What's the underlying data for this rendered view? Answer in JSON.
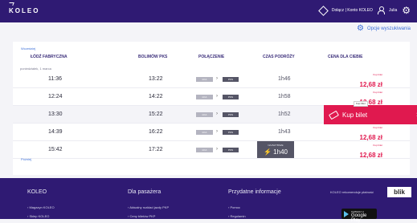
{
  "header": {
    "logo": "KOLEO",
    "account_link": "Dołącz | Konto KOLEO",
    "user_name": "Julia"
  },
  "search_options": "Opcje wyszukiwania",
  "results": {
    "earlier_label": "Wcześniej",
    "later_label": "Później",
    "date_label": "poniedziałek, 1 marca",
    "columns": {
      "from": "ŁÓDŹ FABRYCZNA",
      "to": "BOLIMÓW PKS",
      "connection": "POŁĄCZENIE",
      "duration": "CZAS PODRÓŻY",
      "price": "CENA DLA CIEBIE"
    },
    "rows": [
      {
        "dep": "11:36",
        "arr": "13:22",
        "seg1": "ŁKA",
        "seg2": "PKS",
        "duration": "1h46",
        "price_from": "Kup bilet",
        "price": "12,68 zł"
      },
      {
        "dep": "12:24",
        "arr": "14:22",
        "seg1": "ŁKA",
        "seg2": "PKS",
        "duration": "1h58",
        "price_from": "Kup bilet",
        "price": "12,68 zł"
      },
      {
        "dep": "13:30",
        "arr": "15:22",
        "seg1": "ŁKA",
        "seg2": "PKS",
        "duration": "1h52",
        "price_from": "Kup bilet",
        "price": "12,68 zł"
      },
      {
        "dep": "14:39",
        "arr": "16:22",
        "seg1": "ŁKA",
        "seg2": "PKS",
        "duration": "1h43",
        "price_from": "Kup bilet",
        "price": "12,68 zł"
      },
      {
        "dep": "15:42",
        "arr": "17:22",
        "seg1": "ŁKA",
        "seg2": "PKS",
        "duration": "1h40",
        "duration_label": "NAJSZYBSZE",
        "price_from": "Kup bilet",
        "price": "12,68 zł"
      }
    ],
    "buy_button": "Kup bilet",
    "tooltip": "Kup bilet"
  },
  "footer": {
    "columns": [
      "KOLEO",
      "Dla pasażera",
      "Przydatne informacje"
    ],
    "links_row1": [
      "Magazyn KOLEO",
      "Aktualny rozkład jazdy PKP",
      "Pomoc"
    ],
    "links_row2": [
      "Sklep KOLEO",
      "Ceny biletów PKP",
      "Regulamin"
    ],
    "payment_note": "KOLEO rekomenduje płatność",
    "blik": "blik",
    "google_play_small": "POBIERZ Z",
    "google_play_big": "Google Play"
  },
  "colors": {
    "brand": "#2f1a73",
    "accent": "#e0194f",
    "link": "#3c6fd8"
  }
}
